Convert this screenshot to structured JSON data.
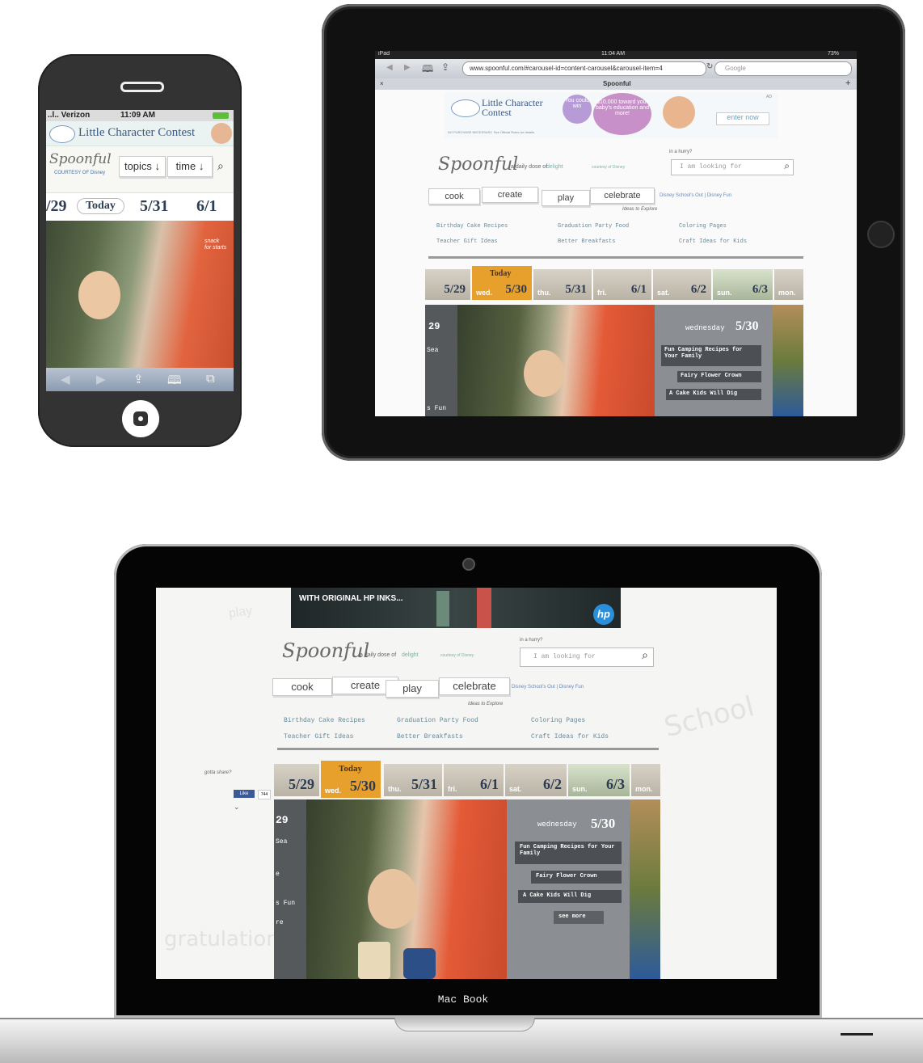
{
  "iphone": {
    "carrier": "..l.. Verizon",
    "time": "11:09 AM",
    "banner_text": "Little Character Contest",
    "logo": "Spoonful",
    "logo_sub": "COURTESY OF Disney",
    "topics_label": "topics ↓",
    "time_label": "time ↓",
    "dates": [
      "/29",
      "Today",
      "5/31",
      "6/1"
    ],
    "photo_tag": "snack for starts",
    "toolbar": {
      "back": "◀",
      "forward": "▶",
      "share": "⇪",
      "bookmarks": "🕮",
      "tabs": "⧉"
    }
  },
  "ipad": {
    "status_left": "iPad",
    "status_time": "11:04 AM",
    "status_battery": "73%",
    "url": "www.spoonful.com/#carousel-id=content-carousel&carousel-item=4",
    "search_placeholder": "Google",
    "tab_title": "Spoonful",
    "ad": {
      "title": "Little Character Contest",
      "bubble1": "You could win",
      "bubble2": "$10,000 toward your baby's education and more!",
      "cta": "enter now",
      "fine": "NO PURCHASE NECESSARY. See Official Rules for details.",
      "tag": "AD"
    }
  },
  "site": {
    "logo": "Spoonful",
    "tagline": "a daily dose of",
    "tagline_word": "delight",
    "courtesy": "courtesy of Disney",
    "hungry": "in a hurry?",
    "search_placeholder": "I am looking for",
    "nav": [
      "cook",
      "create",
      "play",
      "celebrate"
    ],
    "promo": "Disney School's Out | Disney Fun",
    "ideas_header": "Ideas to Explore",
    "ideas": [
      [
        "Birthday Cake Recipes",
        "Graduation Party Food",
        "Coloring Pages"
      ],
      [
        "Teacher Gift Ideas",
        "Better Breakfasts",
        "Craft Ideas for Kids"
      ]
    ],
    "dates": [
      {
        "w": "",
        "d": "5/29"
      },
      {
        "w": "wed.",
        "d": "5/30",
        "today": "Today"
      },
      {
        "w": "thu.",
        "d": "5/31"
      },
      {
        "w": "fri.",
        "d": "6/1"
      },
      {
        "w": "sat.",
        "d": "6/2"
      },
      {
        "w": "sun.",
        "d": "6/3"
      },
      {
        "w": "mon.",
        "d": ""
      }
    ],
    "panel_day": "wednesday",
    "panel_date": "5/30",
    "panel_items": [
      "Fun Camping Recipes for Your Family",
      "Fairy Flower Crown",
      "A Cake Kids Will Dig"
    ],
    "see_more": "see more",
    "left_strip": [
      "29",
      "Sea",
      "e",
      "s Fun",
      "re"
    ],
    "mac_ad_text": "WITH ORIGINAL HP INKS...",
    "hp": "hp",
    "share_label": "gotta share?",
    "like_label": "Like",
    "like_count": "744",
    "bg_words": [
      "School",
      "gratulations",
      "play"
    ]
  },
  "device_label": "Mac Book",
  "colors": {
    "today": "#e8a02c",
    "panel": "#8b8f93",
    "nav_text": "#444444"
  }
}
